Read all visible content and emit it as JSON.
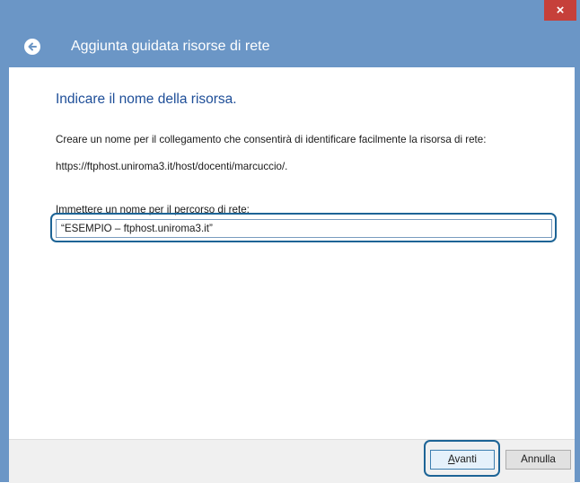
{
  "titlebar": {
    "close_label": "×"
  },
  "header": {
    "title": "Aggiunta guidata risorse di rete"
  },
  "content": {
    "heading": "Indicare il nome della risorsa.",
    "description": "Creare un nome per il collegamento che consentirà di identificare facilmente la risorsa di rete:",
    "url": "https://ftphost.uniroma3.it/host/docenti/marcuccio/.",
    "field_label": "Immettere un nome per il percorso di rete:",
    "field_value": "“ESEMPIO – ftphost.uniroma3.it”"
  },
  "footer": {
    "next_label": "Avanti",
    "cancel_label": "Annulla"
  },
  "colors": {
    "accent": "#6b96c6",
    "heading": "#1e4e98",
    "highlight_ring": "#1d6496",
    "close": "#c6403a"
  }
}
